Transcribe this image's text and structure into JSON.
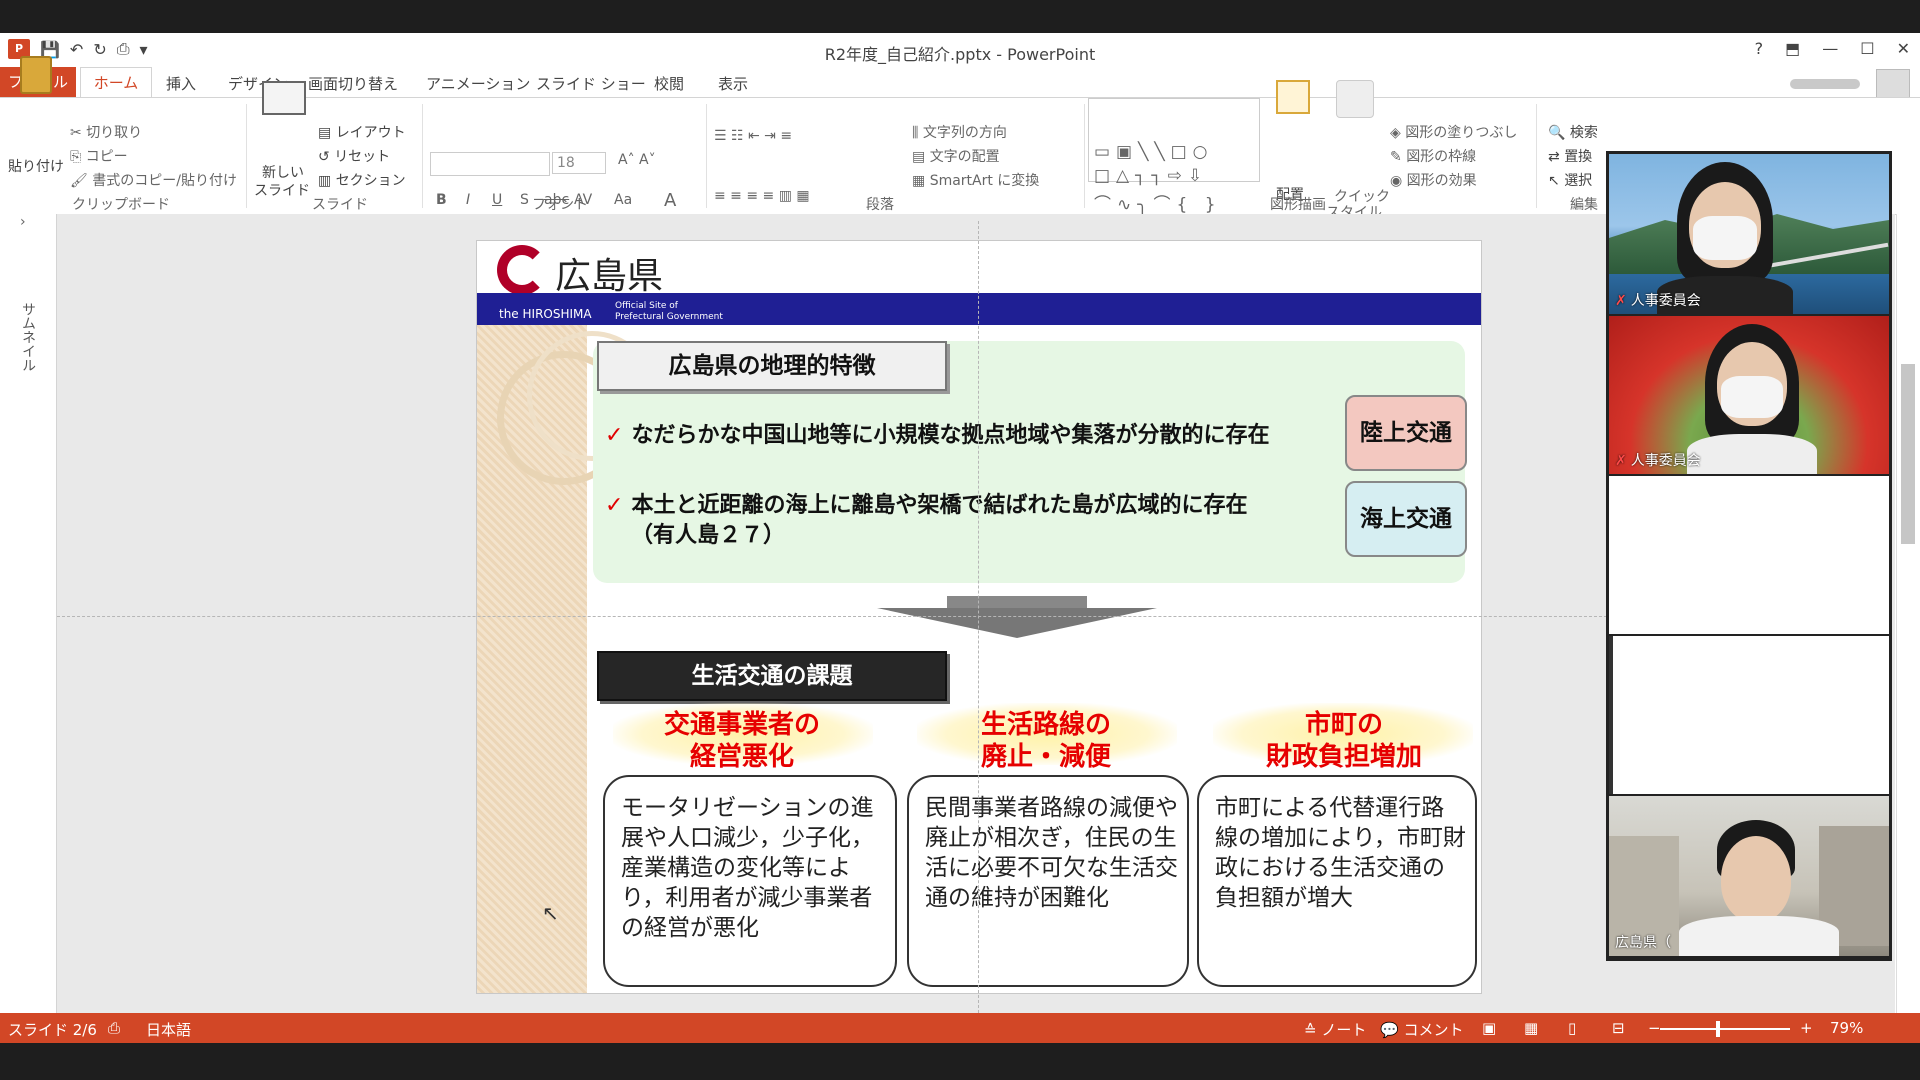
{
  "window": {
    "title": "R2年度_自己紹介.pptx - PowerPoint",
    "help": "?",
    "app_icon": "P"
  },
  "tabs": [
    "ファイル",
    "ホーム",
    "挿入",
    "デザイン",
    "画面切り替え",
    "アニメーション",
    "スライド ショー",
    "校閲",
    "表示"
  ],
  "ribbon": {
    "clipboard": {
      "paste": "貼り付け",
      "cut": "切り取り",
      "copy": "コピー",
      "format_painter": "書式のコピー/貼り付け",
      "group": "クリップボード"
    },
    "slides": {
      "new_slide_1": "新しい",
      "new_slide_2": "スライド",
      "layout": "レイアウト",
      "reset": "リセット",
      "section": "セクション",
      "group": "スライド"
    },
    "font": {
      "size": "18",
      "group": "フォント",
      "bold": "B",
      "italic": "I",
      "underline": "U",
      "shadow": "S",
      "strike": "abc",
      "spacing": "AV",
      "case": "Aa",
      "color": "A"
    },
    "paragraph": {
      "text_direction": "文字列の方向",
      "align_text": "文字の配置",
      "smartart": "SmartArt に変換",
      "group": "段落"
    },
    "drawing": {
      "arrange": "配置",
      "quick_styles_1": "クイック",
      "quick_styles_2": "スタイル",
      "fill": "図形の塗りつぶし",
      "outline": "図形の枠線",
      "effects": "図形の効果",
      "group": "図形描画"
    },
    "editing": {
      "find": "検索",
      "replace": "置換",
      "select": "選択",
      "group": "編集"
    }
  },
  "thumbnail_panel_label": "サムネイル",
  "slide": {
    "logo_text": "広島県",
    "banner_left": "the HIROSHIMA",
    "banner_right_1": "Official Site of",
    "banner_right_2": "Prefectural Government",
    "section1_title": "広島県の地理的特徴",
    "bullet1": "なだらかな中国山地等に小規模な拠点地域や集落が分散的に存在",
    "bullet2_line1": "本土と近距離の海上に離島や架橋で結ばれた島が広域的に存在",
    "bullet2_line2": "（有人島２７）",
    "check_mark": "✓",
    "tag_land": "陸上交通",
    "tag_sea": "海上交通",
    "section2_title": "生活交通の課題",
    "issues": [
      {
        "title_1": "交通事業者の",
        "title_2": "経営悪化",
        "body": "モータリゼーションの進展や人口減少，少子化，産業構造の変化等により，利用者が減少事業者の経営が悪化"
      },
      {
        "title_1": "生活路線の",
        "title_2": "廃止・減便",
        "body": "民間事業者路線の減便や廃止が相次ぎ，住民の生活に必要不可欠な生活交通の維持が困難化"
      },
      {
        "title_1": "市町の",
        "title_2": "財政負担増加",
        "body": "市町による代替運行路線の増加により，市町財政における生活交通の負担額が増大"
      }
    ]
  },
  "video": {
    "participant1": "人事委員会",
    "participant2": "人事委員会",
    "participant3": "広島県（"
  },
  "status": {
    "slide": "スライド 2/6",
    "language": "日本語",
    "notes": "ノート",
    "comments": "コメント",
    "zoom": "79%"
  },
  "colors": {
    "accent": "#d24726",
    "banner": "#1f1f94",
    "issue_red": "#e60000"
  }
}
